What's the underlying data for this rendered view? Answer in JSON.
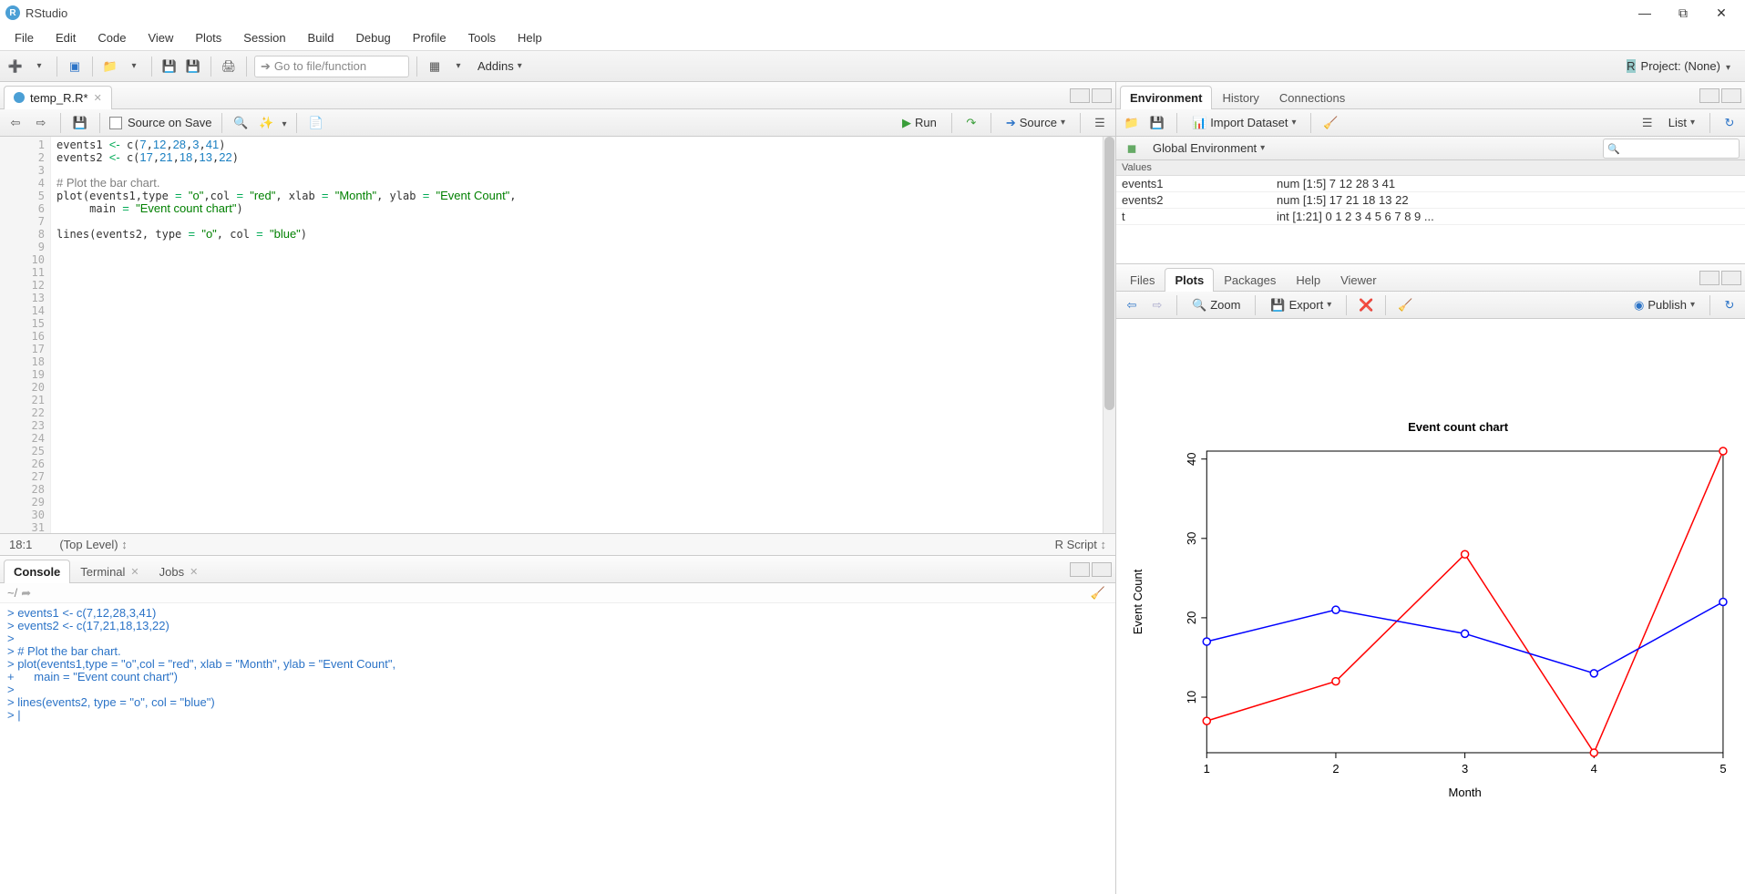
{
  "window": {
    "title": "RStudio"
  },
  "menu": [
    "File",
    "Edit",
    "Code",
    "View",
    "Plots",
    "Session",
    "Build",
    "Debug",
    "Profile",
    "Tools",
    "Help"
  ],
  "toolbar": {
    "goto_placeholder": "Go to file/function",
    "addins": "Addins",
    "project": "Project: (None)"
  },
  "source": {
    "tab_name": "temp_R.R*",
    "source_on_save": "Source on Save",
    "run": "Run",
    "source_btn": "Source",
    "status_pos": "18:1",
    "status_scope": "(Top Level)",
    "status_lang": "R Script",
    "gutter_lines": 31,
    "code_html": "events1 <span class='kw'>&lt;-</span> c(<span class='num'>7</span>,<span class='num'>12</span>,<span class='num'>28</span>,<span class='num'>3</span>,<span class='num'>41</span>)\nevents2 <span class='kw'>&lt;-</span> c(<span class='num'>17</span>,<span class='num'>21</span>,<span class='num'>18</span>,<span class='num'>13</span>,<span class='num'>22</span>)\n\n<span class='cmt'># Plot the bar chart.</span>\nplot(events1,type <span class='kw'>=</span> <span class='str'>\"o\"</span>,col <span class='kw'>=</span> <span class='str'>\"red\"</span>, xlab <span class='kw'>=</span> <span class='str'>\"Month\"</span>, ylab <span class='kw'>=</span> <span class='str'>\"Event Count\"</span>,\n     main <span class='kw'>=</span> <span class='str'>\"Event count chart\"</span>)\n\nlines(events2, type <span class='kw'>=</span> <span class='str'>\"o\"</span>, col <span class='kw'>=</span> <span class='str'>\"blue\"</span>)\n"
  },
  "console": {
    "tabs": [
      "Console",
      "Terminal",
      "Jobs"
    ],
    "path": "~/",
    "output_html": "<span class='blue'>&gt; events1 &lt;- c(7,12,28,3,41)</span>\n<span class='blue'>&gt; events2 &lt;- c(17,21,18,13,22)</span>\n<span class='blue'>&gt; </span>\n<span class='blue'>&gt; # Plot the bar chart.</span>\n<span class='blue'>&gt; plot(events1,type = \"o\",col = \"red\", xlab = \"Month\", ylab = \"Event Count\",</span>\n<span class='blue'>+      main = \"Event count chart\")</span>\n<span class='blue'>&gt; </span>\n<span class='blue'>&gt; lines(events2, type = \"o\", col = \"blue\")</span>\n<span class='blue'>&gt; |</span>"
  },
  "env": {
    "tabs": [
      "Environment",
      "History",
      "Connections"
    ],
    "import": "Import Dataset",
    "scope": "Global Environment",
    "list": "List",
    "section": "Values",
    "rows": [
      {
        "name": "events1",
        "val": "num [1:5] 7 12 28 3 41"
      },
      {
        "name": "events2",
        "val": "num [1:5] 17 21 18 13 22"
      },
      {
        "name": "t",
        "val": "int [1:21] 0 1 2 3 4 5 6 7 8 9 ..."
      }
    ]
  },
  "plots": {
    "tabs": [
      "Files",
      "Plots",
      "Packages",
      "Help",
      "Viewer"
    ],
    "zoom": "Zoom",
    "export": "Export",
    "publish": "Publish"
  },
  "chart_data": {
    "type": "line",
    "title": "Event count chart",
    "xlabel": "Month",
    "ylabel": "Event Count",
    "x": [
      1,
      2,
      3,
      4,
      5
    ],
    "xlim": [
      1,
      5
    ],
    "ylim": [
      3,
      41
    ],
    "yticks": [
      10,
      20,
      30,
      40
    ],
    "series": [
      {
        "name": "events1",
        "color": "red",
        "values": [
          7,
          12,
          28,
          3,
          41
        ]
      },
      {
        "name": "events2",
        "color": "blue",
        "values": [
          17,
          21,
          18,
          13,
          22
        ]
      }
    ]
  }
}
